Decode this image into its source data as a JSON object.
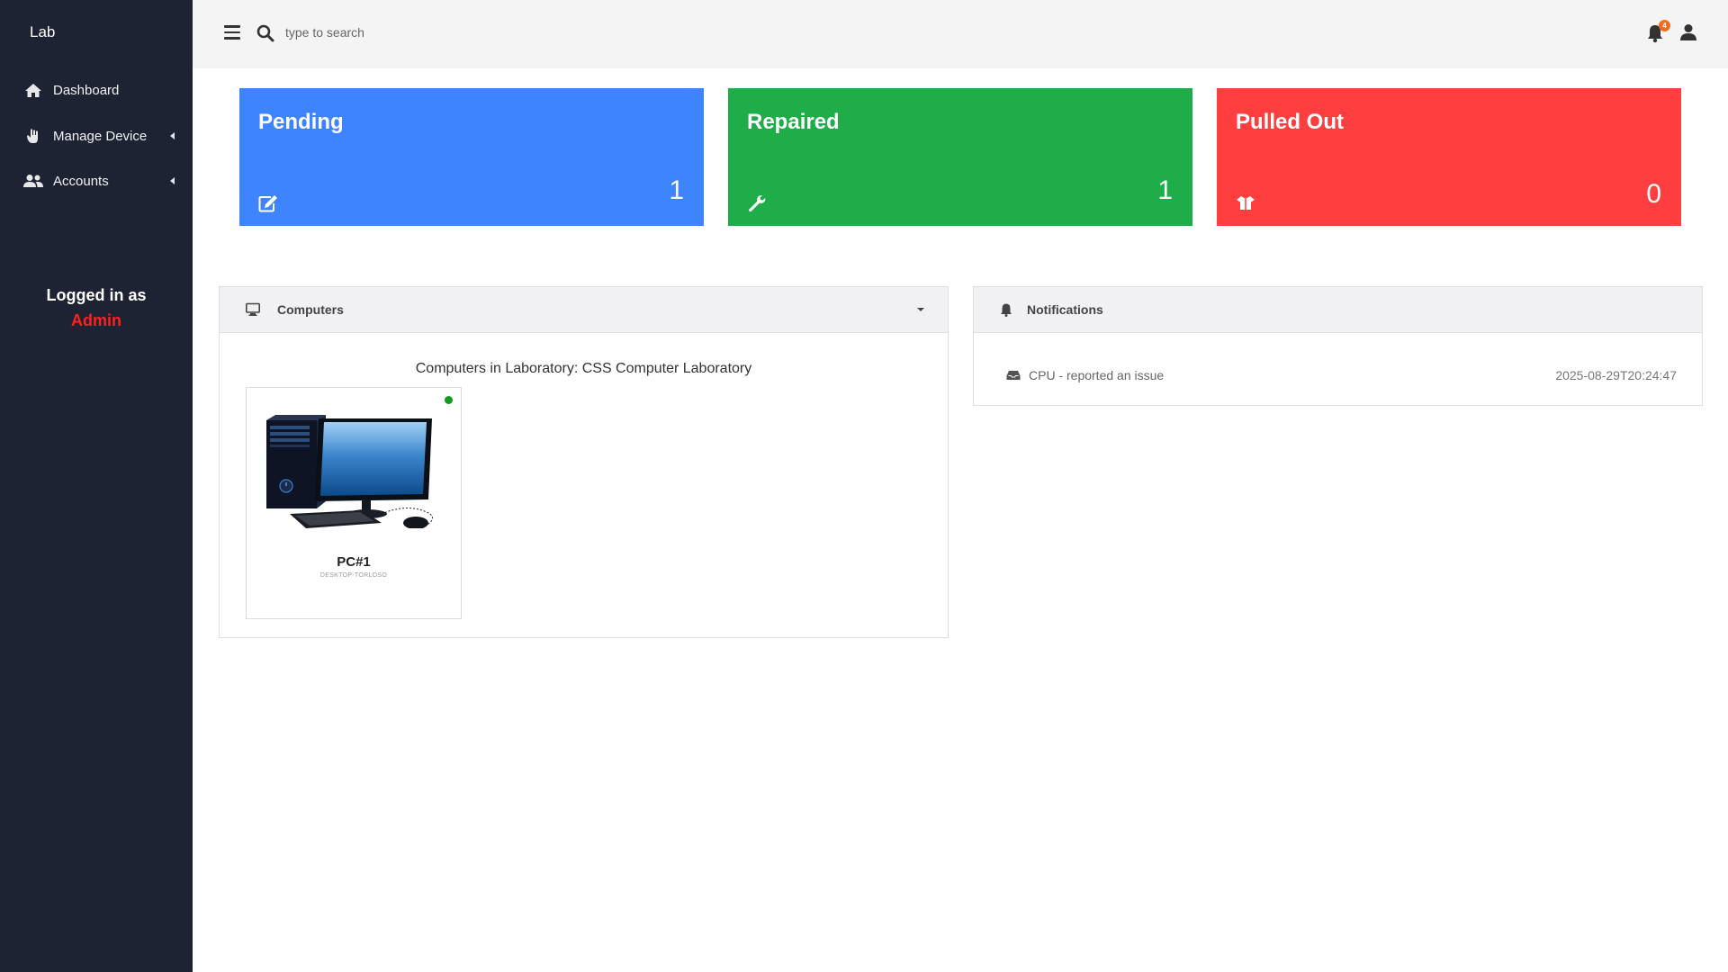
{
  "sidebar": {
    "brand": "Lab",
    "items": [
      {
        "label": "Dashboard",
        "icon": "home-icon"
      },
      {
        "label": "Manage Device",
        "icon": "hand-icon"
      },
      {
        "label": "Accounts",
        "icon": "users-icon"
      }
    ],
    "logged_in_label": "Logged in as",
    "logged_in_user": "Admin"
  },
  "topbar": {
    "search_placeholder": "type to search",
    "notification_count": "4"
  },
  "stats": {
    "pending": {
      "title": "Pending",
      "count": "1",
      "color": "#3d84fd",
      "icon": "edit-icon"
    },
    "repaired": {
      "title": "Repaired",
      "count": "1",
      "color": "#1fad4a",
      "icon": "wrench-icon"
    },
    "pulled_out": {
      "title": "Pulled Out",
      "count": "0",
      "color": "#ff3f3f",
      "icon": "box-icon"
    }
  },
  "computers": {
    "header": "Computers",
    "lab_title": "Computers in Laboratory: CSS Computer Laboratory",
    "items": [
      {
        "name": "PC#1",
        "hostname": "DESKTOP-TORLOSO",
        "status": "online",
        "status_color": "#169a1e"
      }
    ]
  },
  "notifications": {
    "header": "Notifications",
    "items": [
      {
        "text": "CPU - reported an issue",
        "time": "2025-08-29T20:24:47",
        "icon": "inbox-icon"
      }
    ]
  }
}
